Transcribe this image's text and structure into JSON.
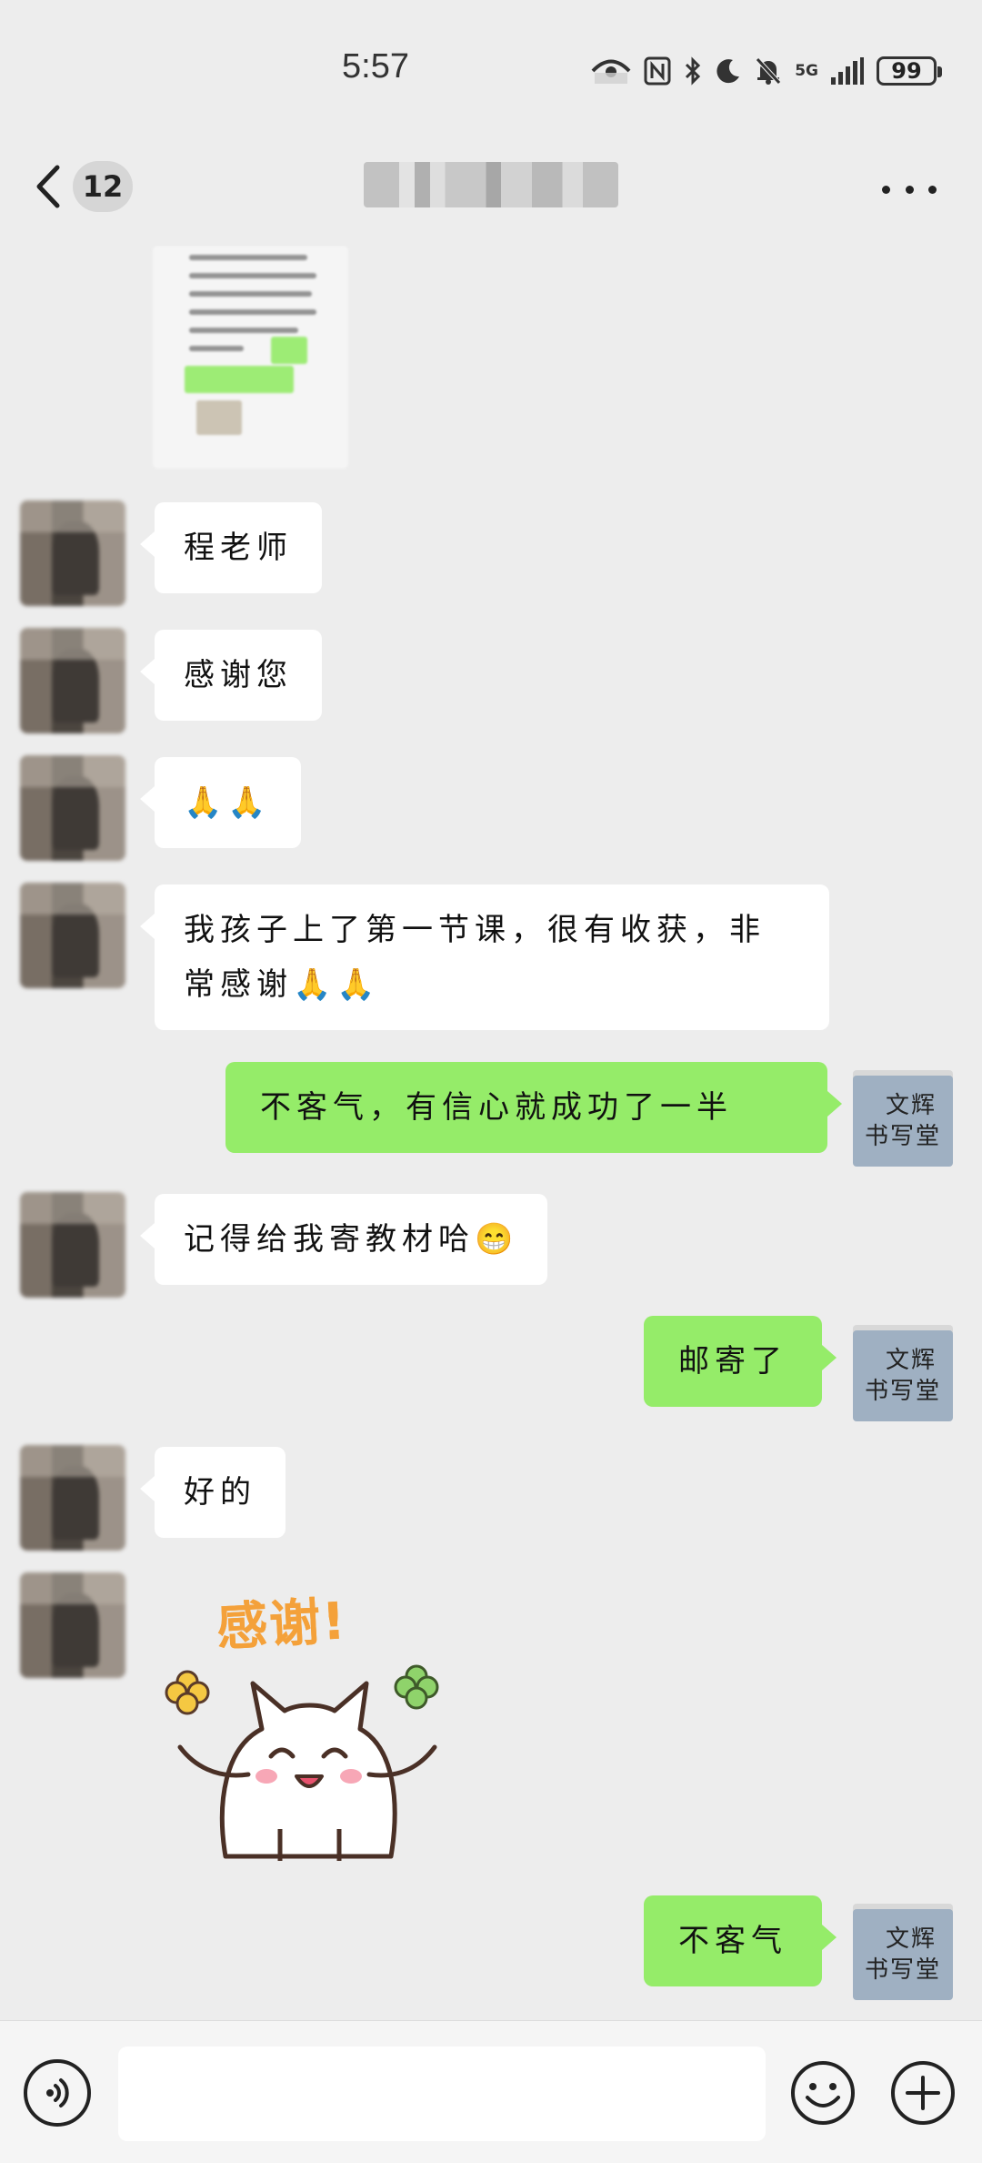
{
  "status_bar": {
    "time": "5:57",
    "network": "5G",
    "battery": "99"
  },
  "title_bar": {
    "unread_count": "12"
  },
  "messages": [
    {
      "side": "in",
      "text": "程老师"
    },
    {
      "side": "in",
      "text": "感谢您"
    },
    {
      "side": "in",
      "text": "🙏🙏"
    },
    {
      "side": "in",
      "text": "我孩子上了第一节课，很有收获，非常感谢🙏🙏"
    },
    {
      "side": "out",
      "text": "不客气，有信心就成功了一半"
    },
    {
      "side": "in",
      "text": "记得给我寄教材哈😁"
    },
    {
      "side": "out",
      "text": "邮寄了"
    },
    {
      "side": "in",
      "text": "好的"
    },
    {
      "side": "in",
      "sticker": "感谢!"
    },
    {
      "side": "out",
      "text": "不客气"
    }
  ],
  "my_avatar": {
    "line1": "文辉",
    "line2": "书写堂"
  },
  "icons": {
    "back": "chevron-left-icon",
    "more": "more-icon",
    "voice": "voice-icon",
    "emoji": "emoji-icon",
    "plus": "plus-icon"
  }
}
